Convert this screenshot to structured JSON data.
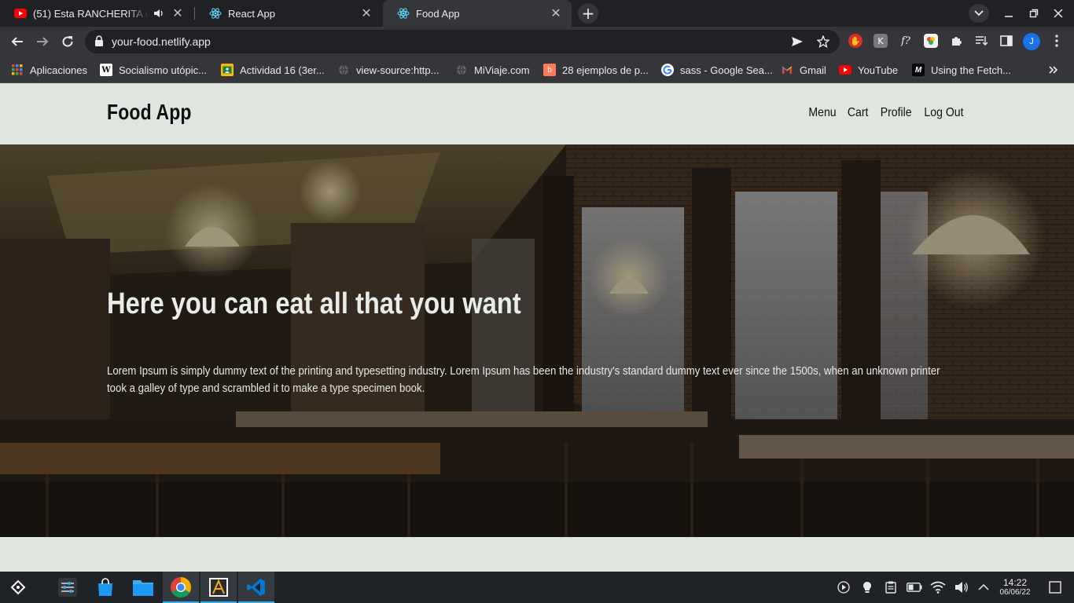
{
  "browser": {
    "tabs": [
      {
        "title": "(51) Esta RANCHERITA con",
        "icon": "youtube-icon",
        "active": false,
        "audio": true
      },
      {
        "title": "React App",
        "icon": "react-icon",
        "active": false
      },
      {
        "title": "Food App",
        "icon": "react-icon",
        "active": true
      }
    ],
    "url": "your-food.netlify.app",
    "profile_initial": "J",
    "bookmarks": [
      {
        "label": "Aplicaciones",
        "icon": "apps-grid-icon"
      },
      {
        "label": "Socialismo utópic...",
        "icon": "wikipedia-icon"
      },
      {
        "label": "Actividad 16 (3er...",
        "icon": "classroom-icon"
      },
      {
        "label": "view-source:http...",
        "icon": "globe-icon"
      },
      {
        "label": "MiViaje.com",
        "icon": "globe-icon"
      },
      {
        "label": "28 ejemplos de p...",
        "icon": "hubspot-icon"
      },
      {
        "label": "sass - Google Sea...",
        "icon": "google-icon"
      },
      {
        "label": "Gmail",
        "icon": "gmail-icon"
      },
      {
        "label": "YouTube",
        "icon": "youtube-icon"
      },
      {
        "label": "Using the Fetch...",
        "icon": "mdn-icon"
      }
    ]
  },
  "site": {
    "logo": "Food App",
    "nav": [
      "Menu",
      "Cart",
      "Profile",
      "Log Out"
    ],
    "hero": {
      "heading": "Here you can eat all that you want",
      "text": "Lorem Ipsum is simply dummy text of the printing and typesetting industry. Lorem Ipsum has been the industry's standard dummy text ever since the 1500s, when an unknown printer took a galley of type and scrambled it to make a type specimen book."
    }
  },
  "taskbar": {
    "time": "14:22",
    "date": "06/06/22"
  },
  "colors": {
    "page_bg": "#dfe6df",
    "chrome_dark": "#202124",
    "chrome_toolbar": "#35363a",
    "accent_blue": "#1a73e8"
  }
}
